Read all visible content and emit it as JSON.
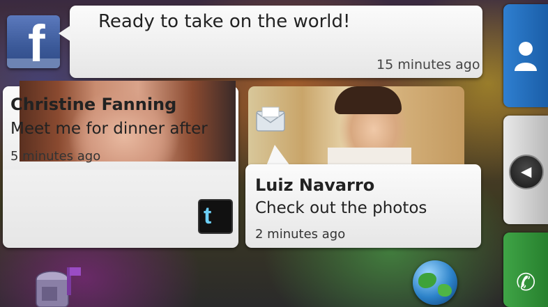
{
  "facebook_widget": {
    "status": "Ready to take on the world!",
    "time": "15 minutes ago"
  },
  "twitter_card": {
    "name": "Christine Fanning",
    "message": "Meet me for dinner after",
    "time": "5 minutes ago"
  },
  "email_card": {
    "name": "Luiz Navarro",
    "message": "Check out the photos",
    "time": "2 minutes ago"
  },
  "icons": {
    "facebook": "facebook-icon",
    "twitter": "twitter-icon",
    "envelope": "envelope-icon",
    "contacts": "person-icon",
    "back": "left-arrow-icon",
    "phone": "phone-icon",
    "mail": "mailbox-icon",
    "browser": "globe-icon"
  },
  "colors": {
    "facebook_blue": "#3b5998",
    "contacts_blue": "#2f7fd0",
    "phone_green": "#3fa446"
  }
}
